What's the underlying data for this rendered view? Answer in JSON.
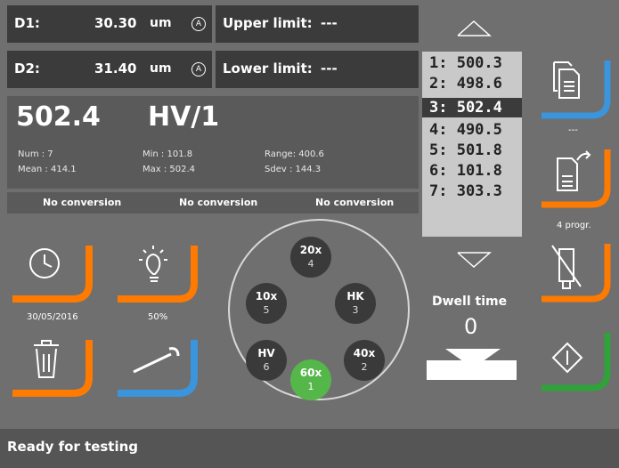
{
  "measurements": {
    "d1": {
      "label": "D1:",
      "value": "30.30",
      "unit": "um",
      "mode": "A"
    },
    "d2": {
      "label": "D2:",
      "value": "31.40",
      "unit": "um",
      "mode": "A"
    },
    "upper_limit": {
      "label": "Upper limit:",
      "value": "---"
    },
    "lower_limit": {
      "label": "Lower limit:",
      "value": "---"
    }
  },
  "result": {
    "value": "502.4",
    "scale": "HV/1",
    "stats": {
      "num": "Num : 7",
      "mean": "Mean : 414.1",
      "min": "Min : 101.8",
      "max": "Max : 502.4",
      "range": "Range: 400.6",
      "sdev": "Sdev : 144.3"
    },
    "conversions": [
      "No conversion",
      "No conversion",
      "No conversion"
    ]
  },
  "results_list": {
    "items": [
      "1: 500.3",
      "2: 498.6",
      "3: 502.4",
      "4: 490.5",
      "5: 501.8",
      "6: 101.8",
      "7: 303.3"
    ],
    "selected_index": 2
  },
  "side_tools": {
    "copy_caption": "---",
    "program_caption": "4 progr."
  },
  "tiles": {
    "date_caption": "30/05/2016",
    "light_caption": "50%"
  },
  "turret": {
    "positions": [
      {
        "label": "20x",
        "num": "4"
      },
      {
        "label": "10x",
        "num": "5"
      },
      {
        "label": "HK",
        "num": "3"
      },
      {
        "label": "HV",
        "num": "6"
      },
      {
        "label": "40x",
        "num": "2"
      },
      {
        "label": "60x",
        "num": "1"
      }
    ],
    "active": "60x"
  },
  "dwell": {
    "label": "Dwell time",
    "value": "0"
  },
  "status": {
    "text": "Ready for testing"
  },
  "colors": {
    "orange": "#ff7a00",
    "blue": "#3a95dd",
    "green": "#2fa23a",
    "turret_active": "#55b74a"
  }
}
